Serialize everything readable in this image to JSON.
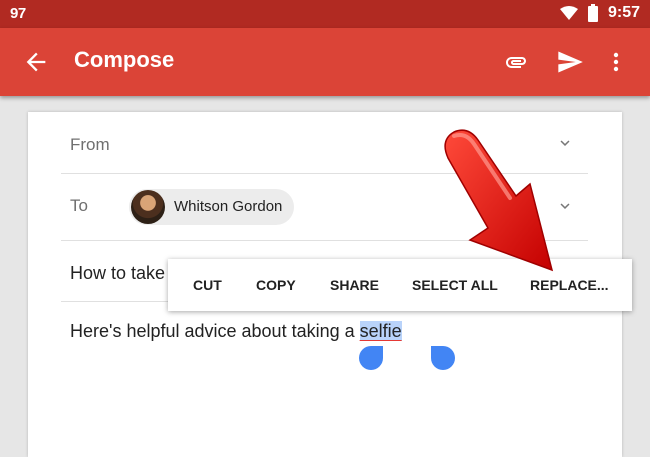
{
  "status_bar": {
    "battery_percent": "97",
    "time": "9:57"
  },
  "app_bar": {
    "title": "Compose",
    "icons": [
      "back-arrow-icon",
      "paperclip-icon",
      "send-icon",
      "more-vert-icon"
    ]
  },
  "form": {
    "from_label": "From",
    "to_label": "To",
    "recipient": "Whitson Gordon",
    "subject_visible": "How to take",
    "body_prefix": "Here's helpful advice about taking a ",
    "body_selected": "selfie"
  },
  "context_menu": {
    "items": [
      "CUT",
      "COPY",
      "SHARE",
      "SELECT ALL",
      "REPLACE..."
    ]
  },
  "colors": {
    "status_bar": "#b12a22",
    "app_bar": "#db4437",
    "selection": "#b9d3fa",
    "handles": "#4285f4",
    "annotation_arrow": "#e8120e"
  }
}
